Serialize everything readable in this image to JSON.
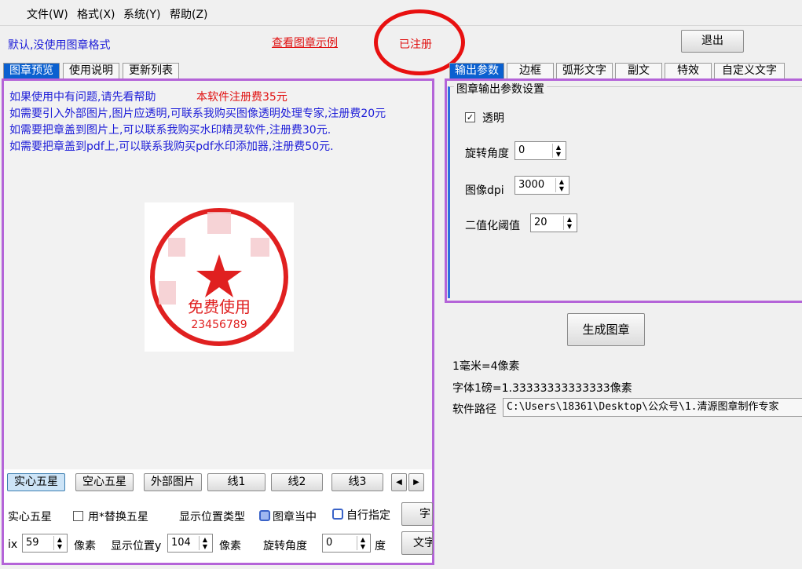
{
  "menu": [
    "文件(W)",
    "格式(X)",
    "系统(Y)",
    "帮助(Z)"
  ],
  "header": {
    "default_text": "默认,没使用图章格式",
    "example_link": "查看图章示例",
    "registered": "已注册",
    "exit_label": "退出"
  },
  "left_tabs": [
    "图章预览",
    "使用说明",
    "更新列表"
  ],
  "notices": {
    "line1": "如果使用中有问题,请先看帮助",
    "fee": "本软件注册费35元",
    "line2": "如需要引入外部图片,图片应透明,可联系我购买图像透明处理专家,注册费20元",
    "line3": "如需要把章盖到图片上,可以联系我购买水印精灵软件,注册费30元.",
    "line4": "如需要把章盖到pdf上,可以联系我购买pdf水印添加器,注册费50元."
  },
  "stamp": {
    "text": "免费使用",
    "number": "23456789",
    "color": "#e02020"
  },
  "shape_buttons": [
    "实心五星",
    "空心五星",
    "外部图片",
    "线1",
    "线2",
    "线3"
  ],
  "bottom": {
    "star_label": "实心五星",
    "replace_label": "用*替换五星",
    "pos_type_label": "显示位置类型",
    "center_label": "图章当中",
    "custom_label": "自行指定",
    "cut_btn1": "字",
    "x_label": "ix",
    "x_value": "59",
    "px_label": "像素",
    "posy_label": "显示位置y",
    "y_value": "104",
    "px_label2": "像素",
    "rot_label": "旋转角度",
    "rot_value": "0",
    "deg_label": "度",
    "cut_btn2": "文字"
  },
  "right_tabs": [
    "输出参数",
    "边框",
    "弧形文字",
    "副文",
    "特效",
    "自定义文字"
  ],
  "output": {
    "group_title": "图章输出参数设置",
    "transparent_label": "透明",
    "transparent_checked": true,
    "rotate_label": "旋转角度",
    "rotate_value": "0",
    "dpi_label": "图像dpi",
    "dpi_value": "3000",
    "threshold_label": "二值化阈值",
    "threshold_value": "20"
  },
  "generate_label": "生成图章",
  "info": {
    "mm": "1毫米=4像素",
    "pt": "字体1磅=1.33333333333333像素",
    "path_label": "软件路径",
    "path_value": "C:\\Users\\18361\\Desktop\\公众号\\1.清源图章制作专家"
  }
}
